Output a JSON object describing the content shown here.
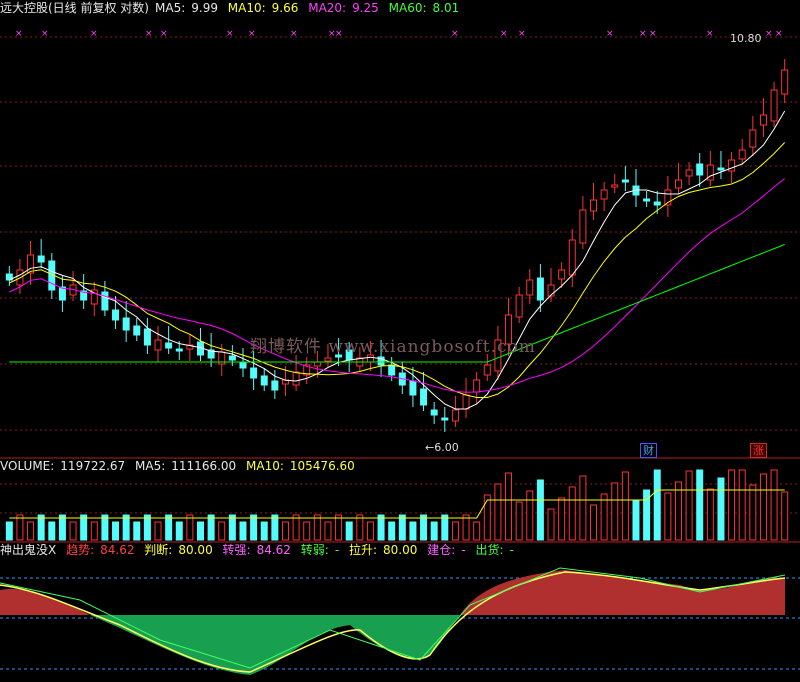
{
  "price_panel": {
    "title": "远大控股(日线 前复权 对数)",
    "ma5_label": "MA5:",
    "ma5_value": "9.99",
    "ma10_label": "MA10:",
    "ma10_value": "9.66",
    "ma20_label": "MA20:",
    "ma20_value": "9.25",
    "ma60_label": "MA60:",
    "ma60_value": "8.01",
    "high_marker": "10.80",
    "low_marker": "6.00",
    "tag_cai": "财",
    "tag_zhang": "涨",
    "watermark": "翔博软件 www.xiangbosoft.com",
    "colors": {
      "up": "#ff3232",
      "down": "#54fcfc",
      "ma5": "#ffffff",
      "ma10": "#ffff00",
      "ma20": "#ff00ff",
      "ma60": "#00ff00",
      "grid": "#8c1c1c"
    }
  },
  "volume_panel": {
    "label": "VOLUME:",
    "value": "119722.67",
    "ma5_label": "MA5:",
    "ma5_value": "111166.00",
    "ma10_label": "MA10:",
    "ma10_value": "105476.60"
  },
  "indicator_panel": {
    "name": "神出鬼没X",
    "trend_label": "趋势:",
    "trend_value": "84.62",
    "judge_label": "判断:",
    "judge_value": "80.00",
    "strong_label": "转强:",
    "strong_value": "84.62",
    "weak_label": "转弱:",
    "weak_value": "-",
    "rise_label": "拉升:",
    "rise_value": "80.00",
    "build_label": "建仓:",
    "build_value": "-",
    "ship_label": "出货:",
    "ship_value": "-"
  }
}
